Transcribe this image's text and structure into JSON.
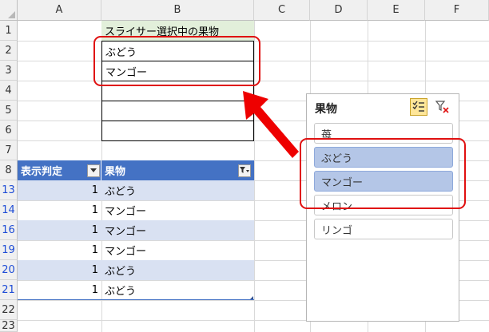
{
  "columns": [
    "A",
    "B",
    "C",
    "D",
    "E",
    "F"
  ],
  "rows": [
    "1",
    "2",
    "3",
    "4",
    "5",
    "6",
    "7",
    "8",
    "13",
    "14",
    "16",
    "19",
    "20",
    "21",
    "22",
    "23"
  ],
  "selection_area": {
    "header": "スライサー選択中の果物",
    "values": [
      "ぶどう",
      "マンゴー",
      "",
      "",
      ""
    ]
  },
  "table": {
    "headers": [
      "表示判定",
      "果物"
    ],
    "rows": [
      {
        "flag": "1",
        "fruit": "ぶどう"
      },
      {
        "flag": "1",
        "fruit": "マンゴー"
      },
      {
        "flag": "1",
        "fruit": "マンゴー"
      },
      {
        "flag": "1",
        "fruit": "マンゴー"
      },
      {
        "flag": "1",
        "fruit": "ぶどう"
      },
      {
        "flag": "1",
        "fruit": "ぶどう"
      }
    ]
  },
  "slicer": {
    "title": "果物",
    "items": [
      {
        "label": "苺",
        "selected": false
      },
      {
        "label": "ぶどう",
        "selected": true
      },
      {
        "label": "マンゴー",
        "selected": true
      },
      {
        "label": "メロン",
        "selected": false
      },
      {
        "label": "リンゴ",
        "selected": false
      }
    ]
  },
  "colors": {
    "header_bg": "#4472c4",
    "band": "#d9e1f2",
    "selected_item": "#b4c6e7",
    "highlight": "#e01010",
    "b1_fill": "#e2efda"
  }
}
